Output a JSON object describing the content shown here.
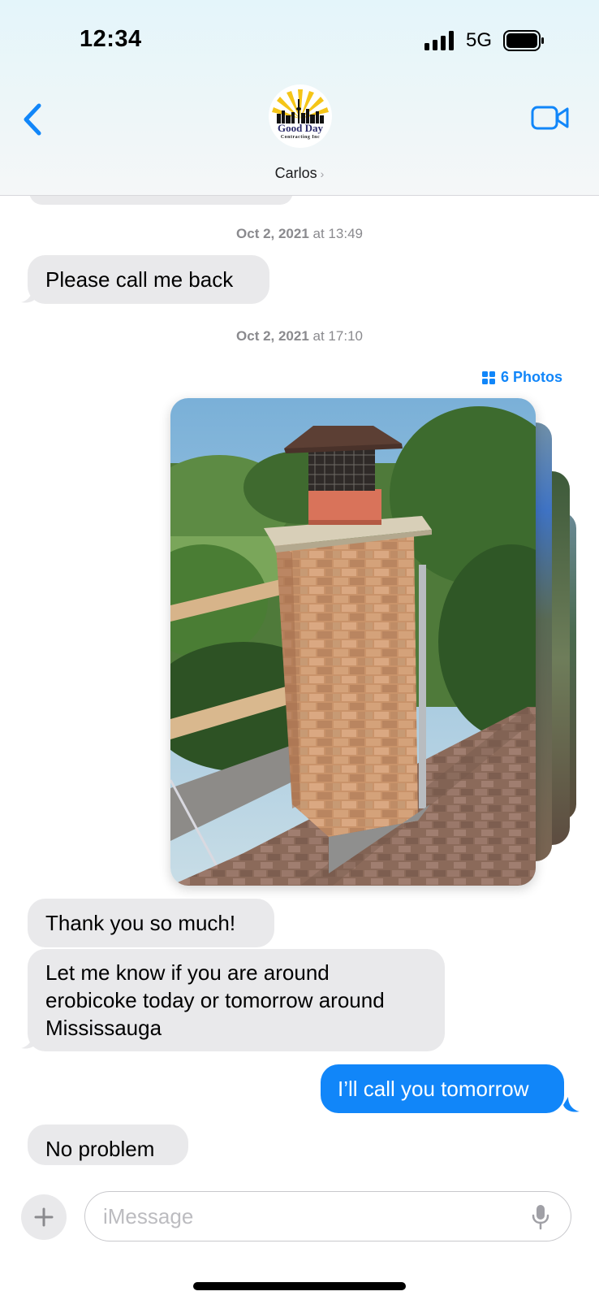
{
  "status_bar": {
    "time": "12:34",
    "network": "5G"
  },
  "header": {
    "contact_name": "Carlos",
    "avatar_logo": {
      "line1": "Good Day",
      "line2": "Contracting Inc"
    }
  },
  "messages": {
    "timestamp1": {
      "date": "Oct 2, 2021",
      "time": "at 13:49"
    },
    "msg1": "Please call me back",
    "timestamp2": {
      "date": "Oct 2, 2021",
      "time": "at 17:10"
    },
    "photos_label": "6 Photos",
    "msg2": "Thank you so much!",
    "msg3_lines": [
      "Let me know if you are around",
      "erobicoke today or tomorrow around",
      "Mississauga"
    ],
    "msg4": "I’ll call you tomorrow",
    "msg5": "No problem"
  },
  "composer": {
    "placeholder": "iMessage"
  },
  "colors": {
    "accent": "#1186f9",
    "incoming_bubble": "#e9e9eb"
  }
}
